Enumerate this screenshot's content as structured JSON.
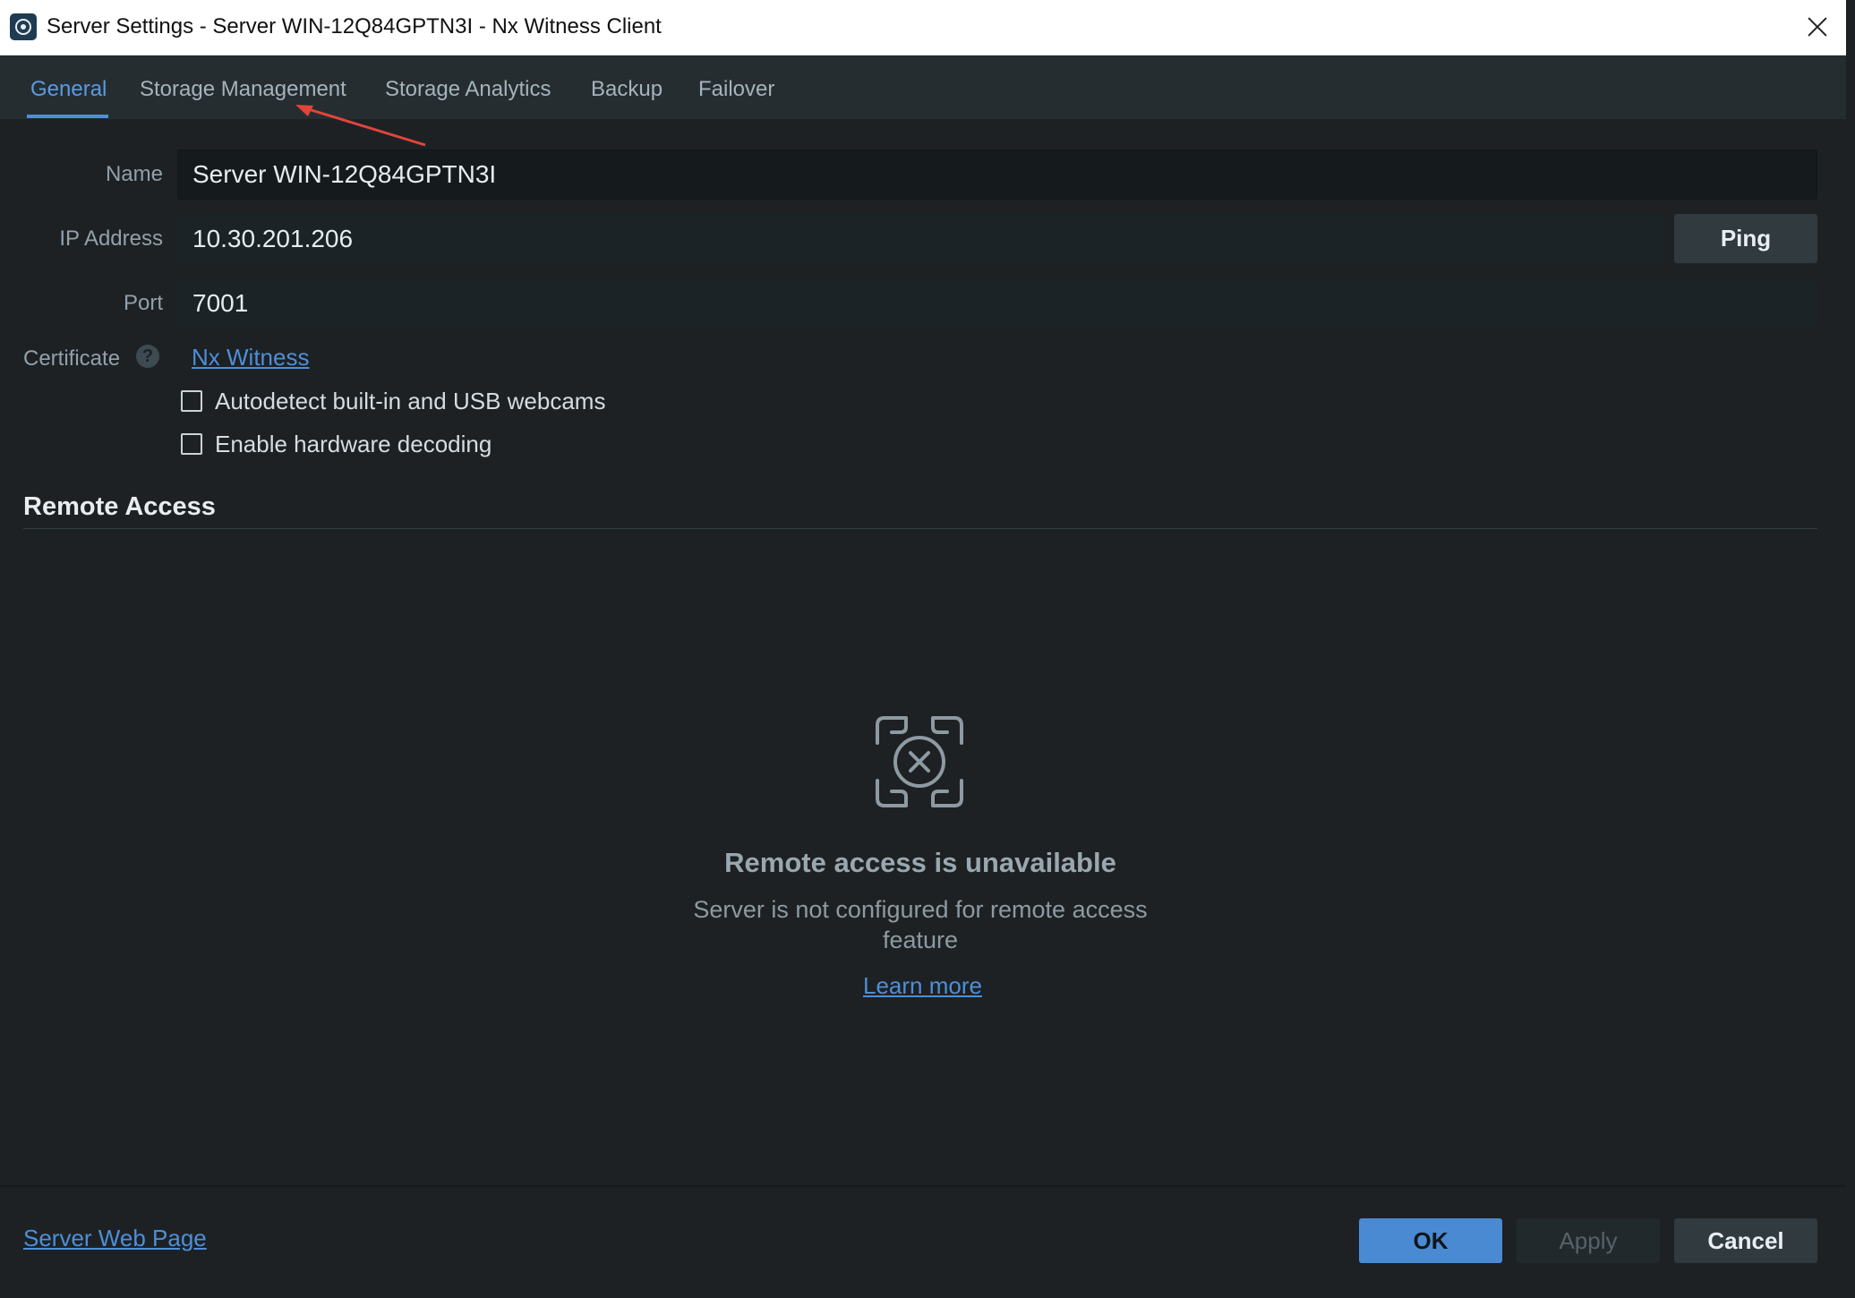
{
  "window": {
    "title": "Server Settings - Server WIN-12Q84GPTN3I - Nx Witness Client"
  },
  "tabs": [
    {
      "label": "General",
      "active": true
    },
    {
      "label": "Storage Management",
      "active": false
    },
    {
      "label": "Storage Analytics",
      "active": false
    },
    {
      "label": "Backup",
      "active": false
    },
    {
      "label": "Failover",
      "active": false
    }
  ],
  "form": {
    "name_label": "Name",
    "name_value": "Server WIN-12Q84GPTN3I",
    "ip_label": "IP Address",
    "ip_value": "10.30.201.206",
    "ping_label": "Ping",
    "port_label": "Port",
    "port_value": "7001",
    "certificate_label": "Certificate",
    "certificate_help_icon": "?",
    "certificate_link": "Nx Witness",
    "checkbox_webcams": {
      "label": "Autodetect built-in and USB webcams",
      "checked": false
    },
    "checkbox_hw_decoding": {
      "label": "Enable hardware decoding",
      "checked": false
    }
  },
  "remote_access": {
    "section_title": "Remote Access",
    "icon": "remote-unavailable-icon",
    "title": "Remote access is unavailable",
    "description": "Server is not configured for remote access feature",
    "learn_more": "Learn more"
  },
  "footer": {
    "server_web_page": "Server Web Page",
    "ok_label": "OK",
    "apply_label": "Apply",
    "cancel_label": "Cancel"
  },
  "colors": {
    "accent": "#4d8fd8",
    "background": "#1d2124",
    "tabbar": "#262d31",
    "annotation_arrow": "#e0453a"
  }
}
